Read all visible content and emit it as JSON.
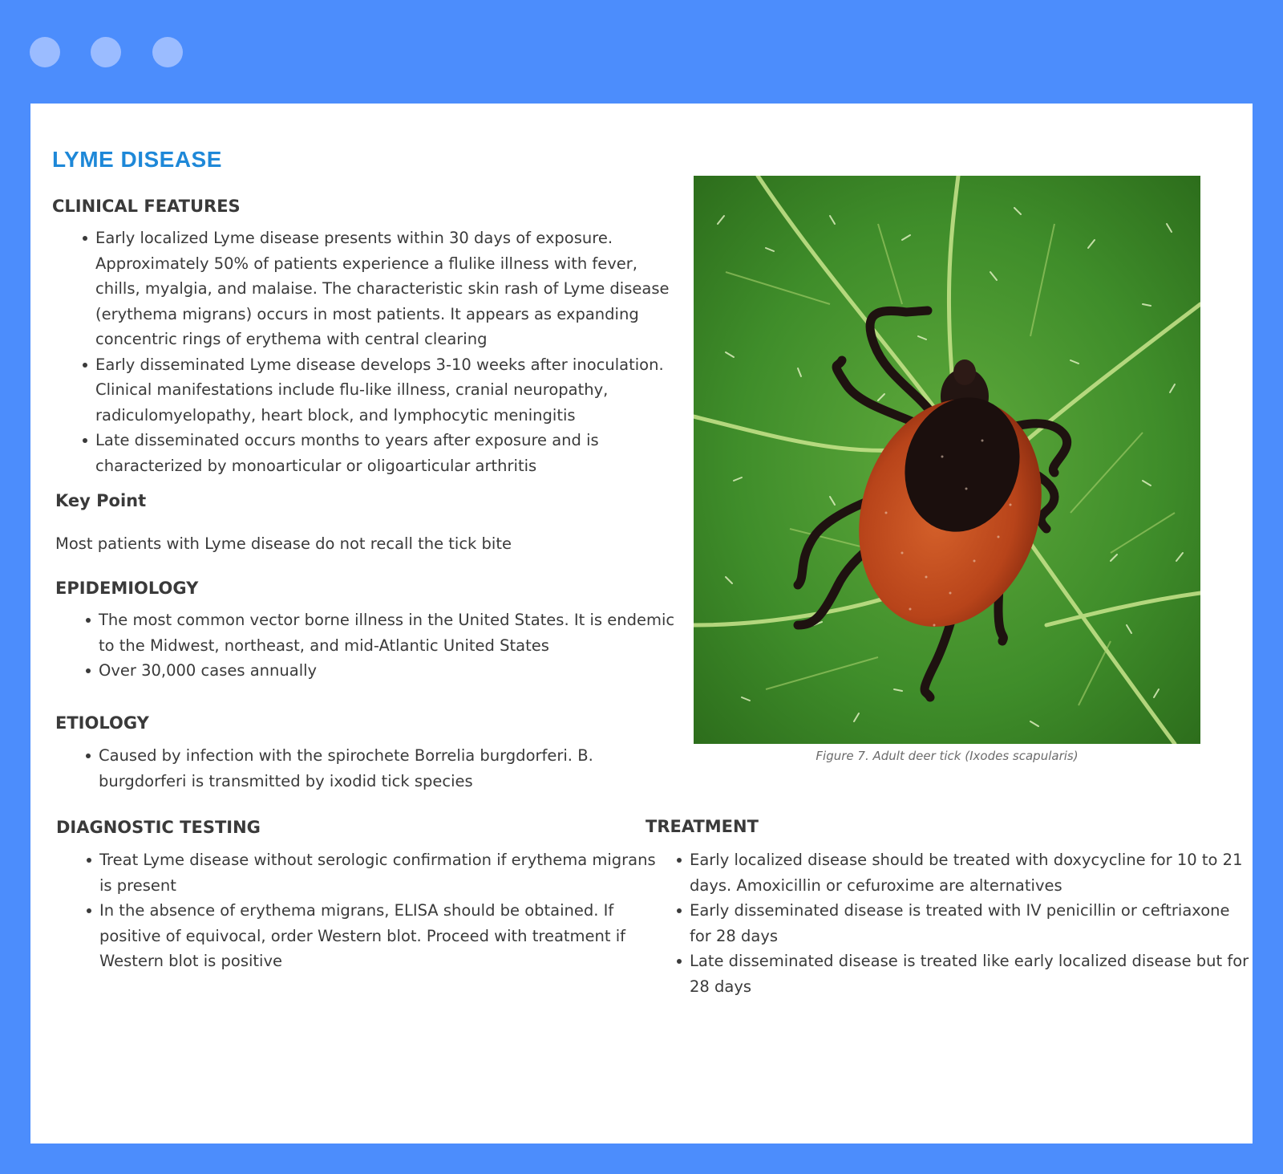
{
  "window": {
    "controls": [
      "window-dot-1",
      "window-dot-2",
      "window-dot-3"
    ]
  },
  "colors": {
    "frame": "#4c8dfc",
    "title": "#1e88d8",
    "page": "#ffffff"
  },
  "page": {
    "title": "LYME DISEASE",
    "clinical_features": {
      "heading": "CLINICAL FEATURES",
      "items": [
        "Early localized Lyme disease presents within 30 days of exposure. Approximately 50% of patients experience a flulike illness with fever, chills, myalgia, and malaise. The characteristic skin rash of Lyme disease (erythema migrans) occurs in most patients. It appears as expanding concentric rings of erythema with central clearing",
        "Early disseminated Lyme disease develops 3-10 weeks after inoculation. Clinical manifestations include flu-like illness, cranial neuropathy, radiculomyelopathy, heart block, and lymphocytic meningitis",
        "Late disseminated occurs months to years after exposure and is characterized by monoarticular or oligoarticular arthritis"
      ]
    },
    "key_point": {
      "heading": "Key Point",
      "text": "Most patients with Lyme disease do not recall the tick bite"
    },
    "epidemiology": {
      "heading": "EPIDEMIOLOGY",
      "items": [
        "The most common vector borne illness in the United States. It is endemic to the Midwest, northeast, and mid-Atlantic United States",
        "Over 30,000 cases annually"
      ]
    },
    "etiology": {
      "heading": "ETIOLOGY",
      "items": [
        "Caused by infection with the spirochete Borrelia burgdorferi. B. burgdorferi is transmitted by ixodid tick species"
      ]
    },
    "figure": {
      "caption": "Figure 7. Adult deer tick (Ixodes scapularis)"
    },
    "diagnostic_testing": {
      "heading": "DIAGNOSTIC TESTING",
      "items": [
        "Treat Lyme disease without serologic confirmation if erythema migrans is present",
        "In the absence of erythema migrans, ELISA should be obtained. If positive of equivocal, order Western blot. Proceed with treatment if Western blot is positive"
      ]
    },
    "treatment": {
      "heading": "TREATMENT",
      "items": [
        "Early localized disease should be treated with doxycycline for 10 to 21 days. Amoxicillin or cefuroxime are alternatives",
        "Early disseminated disease is treated with IV penicillin or ceftriaxone for 28 days",
        "Late disseminated disease is treated like early localized disease but for 28 days"
      ]
    }
  }
}
